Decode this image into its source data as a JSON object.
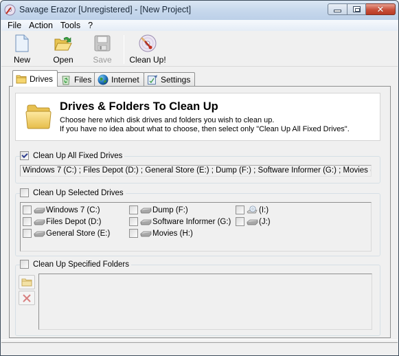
{
  "window": {
    "title": "Savage Erazor [Unregistered] - [New Project]",
    "controls": {
      "minimize": "minimize",
      "maximize": "maximize",
      "close": "close"
    }
  },
  "menu": {
    "items": [
      {
        "label": "File"
      },
      {
        "label": "Action"
      },
      {
        "label": "Tools"
      },
      {
        "label": "?"
      }
    ]
  },
  "toolbar": {
    "buttons": [
      {
        "label": "New",
        "icon": "new-document-icon",
        "enabled": true
      },
      {
        "label": "Open",
        "icon": "open-folder-icon",
        "enabled": true
      },
      {
        "label": "Save",
        "icon": "save-floppy-icon",
        "enabled": false
      },
      {
        "label": "Clean Up!",
        "icon": "clean-up-disc-icon",
        "enabled": true
      }
    ]
  },
  "tabs": [
    {
      "label": "Drives",
      "icon": "folder-icon",
      "active": true
    },
    {
      "label": "Files",
      "icon": "recycle-bin-icon",
      "active": false
    },
    {
      "label": "Internet",
      "icon": "globe-icon",
      "active": false
    },
    {
      "label": "Settings",
      "icon": "settings-icon",
      "active": false
    }
  ],
  "drives_panel": {
    "header": {
      "title": "Drives & Folders To Clean Up",
      "line1": "Choose here which disk drives and folders you wish to clean up.",
      "line2": "If you have no idea about what to choose, then select only \"Clean Up All Fixed Drives\"."
    },
    "all_fixed": {
      "label": "Clean Up All Fixed Drives",
      "checked": true,
      "drives_text": "Windows 7 (C:) ; Files Depot (D:) ; General Store (E:) ; Dump (F:) ; Software Informer (G:) ; Movies (H:) ;"
    },
    "selected_drives": {
      "label": "Clean Up Selected Drives",
      "checked": false,
      "drives": [
        {
          "label": "Windows 7 (C:)",
          "type": "hdd",
          "checked": false
        },
        {
          "label": "Files Depot (D:)",
          "type": "hdd",
          "checked": false
        },
        {
          "label": "General Store (E:)",
          "type": "hdd",
          "checked": false
        },
        {
          "label": "Dump (F:)",
          "type": "hdd",
          "checked": false
        },
        {
          "label": "Software Informer (G:)",
          "type": "hdd",
          "checked": false
        },
        {
          "label": "Movies (H:)",
          "type": "hdd",
          "checked": false
        },
        {
          "label": "(I:)",
          "type": "cdrom",
          "checked": false
        },
        {
          "label": "(J:)",
          "type": "hdd",
          "checked": false
        }
      ]
    },
    "specified_folders": {
      "label": "Clean Up Specified Folders",
      "checked": false,
      "add_folder_tooltip": "add-folder",
      "remove_folder_tooltip": "remove-folder",
      "folders": []
    }
  },
  "statusbar": {
    "text": ""
  }
}
